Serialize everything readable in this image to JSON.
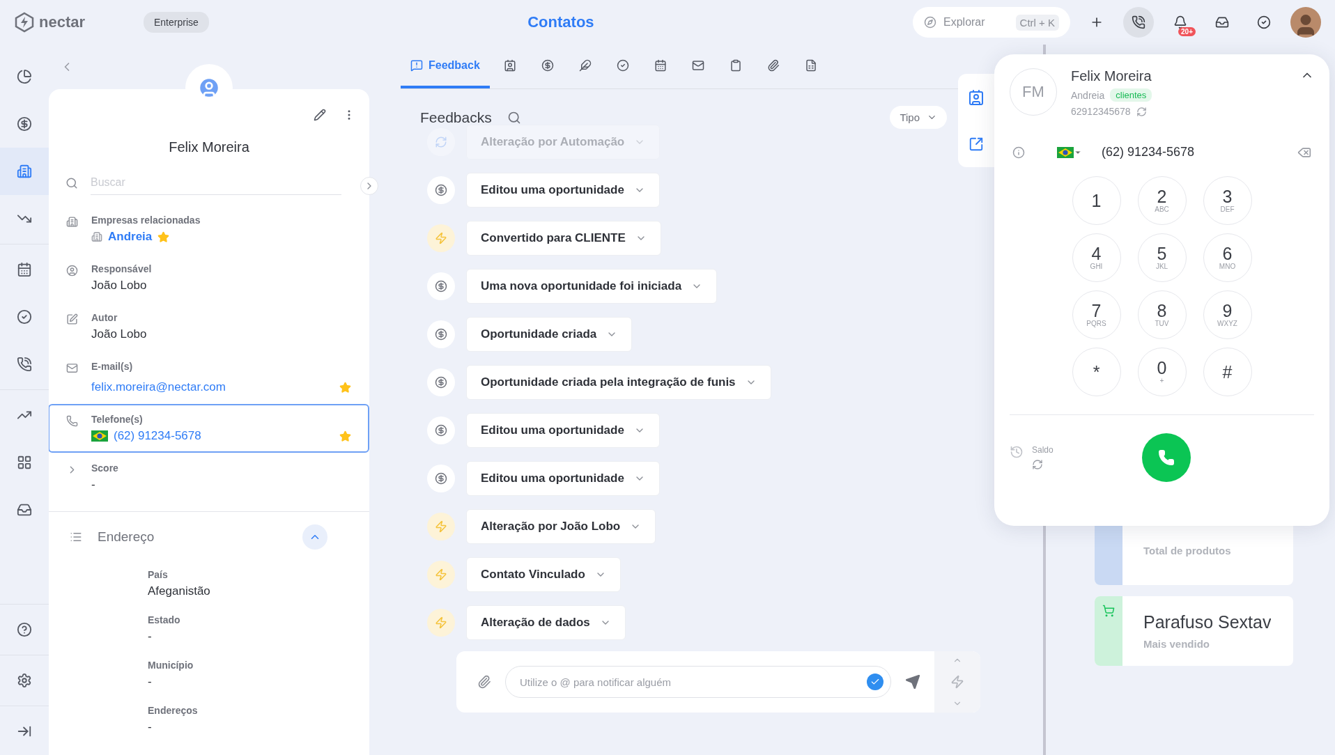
{
  "topbar": {
    "brand": "nectar",
    "plan": "Enterprise",
    "title": "Contatos",
    "explore": {
      "label": "Explorar",
      "shortcut": "Ctrl + K"
    },
    "actions": [
      {
        "active": false
      },
      {
        "active": true
      },
      {
        "active": false,
        "badge": "20+"
      },
      {
        "active": false
      },
      {
        "active": false
      }
    ]
  },
  "nav": [
    {
      "selected": false
    },
    {
      "selected": false
    },
    {
      "selected": true
    },
    {
      "selected": false
    },
    {
      "selected": false
    },
    {
      "selected": false
    },
    {
      "selected": false
    },
    {
      "selected": false
    },
    {
      "selected": false
    },
    {
      "selected": false
    },
    {
      "selected": false
    },
    {
      "selected": false
    },
    {
      "selected": false
    }
  ],
  "contact": {
    "name": "Felix Moreira",
    "search": {
      "placeholder": "Buscar"
    },
    "fields": [
      {
        "kind": "company",
        "label": "Empresas relacionadas",
        "value": "Andreia",
        "starred": true,
        "selected": false
      },
      {
        "kind": "owner",
        "label": "Responsável",
        "value": "João Lobo",
        "starred": false,
        "selected": false
      },
      {
        "kind": "author",
        "label": "Autor",
        "value": "João Lobo",
        "starred": false,
        "selected": false
      },
      {
        "kind": "email",
        "label": "E-mail(s)",
        "value": "felix.moreira@nectar.com",
        "starred": true,
        "selected": false
      },
      {
        "kind": "phone",
        "label": "Telefone(s)",
        "value": "(62) 91234-5678",
        "starred": true,
        "selected": true
      },
      {
        "kind": "score",
        "label": "Score",
        "value": "-",
        "starred": false,
        "selected": false
      }
    ],
    "address": {
      "title": "Endereço",
      "expanded": true,
      "fields": [
        {
          "label": "País",
          "value": "Afeganistão"
        },
        {
          "label": "Estado",
          "value": "-"
        },
        {
          "label": "Município",
          "value": "-"
        },
        {
          "label": "Endereços",
          "value": "-"
        }
      ]
    }
  },
  "tabs": [
    {
      "label": "Feedback",
      "selected": true
    },
    {
      "selected": false
    },
    {
      "selected": false
    },
    {
      "selected": false
    },
    {
      "selected": false
    },
    {
      "selected": false
    },
    {
      "selected": false
    },
    {
      "selected": false
    },
    {
      "selected": false
    },
    {
      "selected": false
    }
  ],
  "feed": {
    "title": "Feedbacks",
    "filter": "Tipo",
    "items": [
      {
        "kind": "automation",
        "text": "Alteração por Automação",
        "faded": true
      },
      {
        "kind": "money",
        "text": "Editou uma oportunidade",
        "faded": false
      },
      {
        "kind": "bolt",
        "text": "Convertido para CLIENTE",
        "faded": false
      },
      {
        "kind": "money",
        "text": "Uma nova oportunidade foi iniciada",
        "faded": false
      },
      {
        "kind": "money",
        "text": "Oportunidade criada",
        "faded": false
      },
      {
        "kind": "money",
        "text": "Oportunidade criada pela integração de funis",
        "faded": false
      },
      {
        "kind": "money",
        "text": "Editou uma oportunidade",
        "faded": false
      },
      {
        "kind": "money",
        "text": "Editou uma oportunidade",
        "faded": false
      },
      {
        "kind": "bolt",
        "text": "Alteração por João Lobo",
        "faded": false
      },
      {
        "kind": "bolt",
        "text": "Contato Vinculado",
        "faded": false
      },
      {
        "kind": "bolt",
        "text": "Alteração de dados",
        "faded": false
      }
    ],
    "composer": {
      "placeholder": "Utilize o @ para notificar alguém"
    }
  },
  "products": [
    {
      "kind": "total",
      "label": "Total de produtos",
      "color": "#c9d9f3"
    },
    {
      "kind": "top",
      "title": "Parafuso Sextav",
      "label": "Mais vendido",
      "color": "#cdf2db"
    }
  ],
  "dialer": {
    "initials": "FM",
    "name": "Felix Moreira",
    "company": "Andreia",
    "tag": "clientes",
    "number": "62912345678",
    "input": "(62) 91234-5678",
    "keys": [
      {
        "digit": "1"
      },
      {
        "digit": "2",
        "letters": "ABC"
      },
      {
        "digit": "3",
        "letters": "DEF"
      },
      {
        "digit": "4",
        "letters": "GHI"
      },
      {
        "digit": "5",
        "letters": "JKL"
      },
      {
        "digit": "6",
        "letters": "MNO"
      },
      {
        "digit": "7",
        "letters": "PQRS"
      },
      {
        "digit": "8",
        "letters": "TUV"
      },
      {
        "digit": "9",
        "letters": "WXYZ"
      },
      {
        "digit": "*"
      },
      {
        "digit": "0",
        "letters": "+"
      },
      {
        "digit": "#"
      }
    ],
    "balance_label": "Saldo"
  }
}
